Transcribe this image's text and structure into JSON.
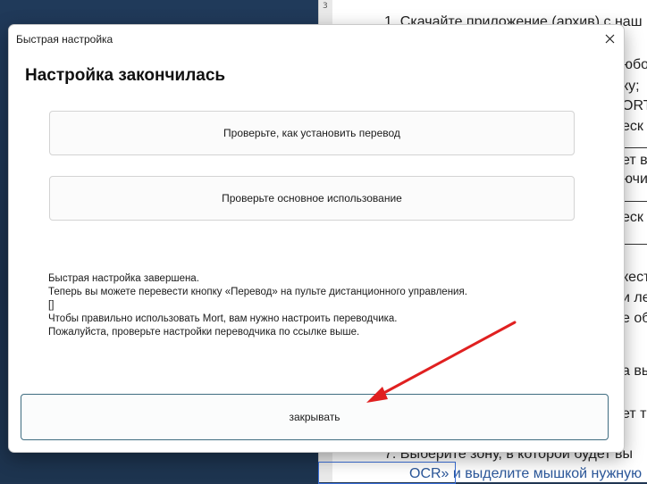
{
  "dialog": {
    "title": "Быстрая настройка",
    "heading": "Настройка закончилась",
    "option_install": "Проверьте, как установить перевод",
    "option_usage": "Проверьте основное использование",
    "message_lines": [
      "Быстрая настройка завершена.",
      "Теперь вы можете перевести кнопку «Перевод» на пульте дистанционного управления.",
      "[]",
      "Чтобы правильно использовать Mort, вам нужно настроить переводчика.",
      "Пожалуйста, проверьте настройки переводчика по ссылке выше."
    ],
    "close_label": "закрывать"
  },
  "background_doc": {
    "ruler_mark": "3",
    "lines": [
      "1.    Скачайте приложение (архив) с наш",
      "юбос",
      "ку;",
      "ORT",
      "еск",
      "ет в",
      "ючи",
      "еск",
      "кест",
      "и ле",
      "е об",
      "а вы",
      "ет т",
      "7.    Выберите зону, в которой будет вы",
      "OCR» и выделите мышкой нужную"
    ]
  },
  "colors": {
    "accent_border": "#3f6d80",
    "arrow": "#e02020"
  }
}
